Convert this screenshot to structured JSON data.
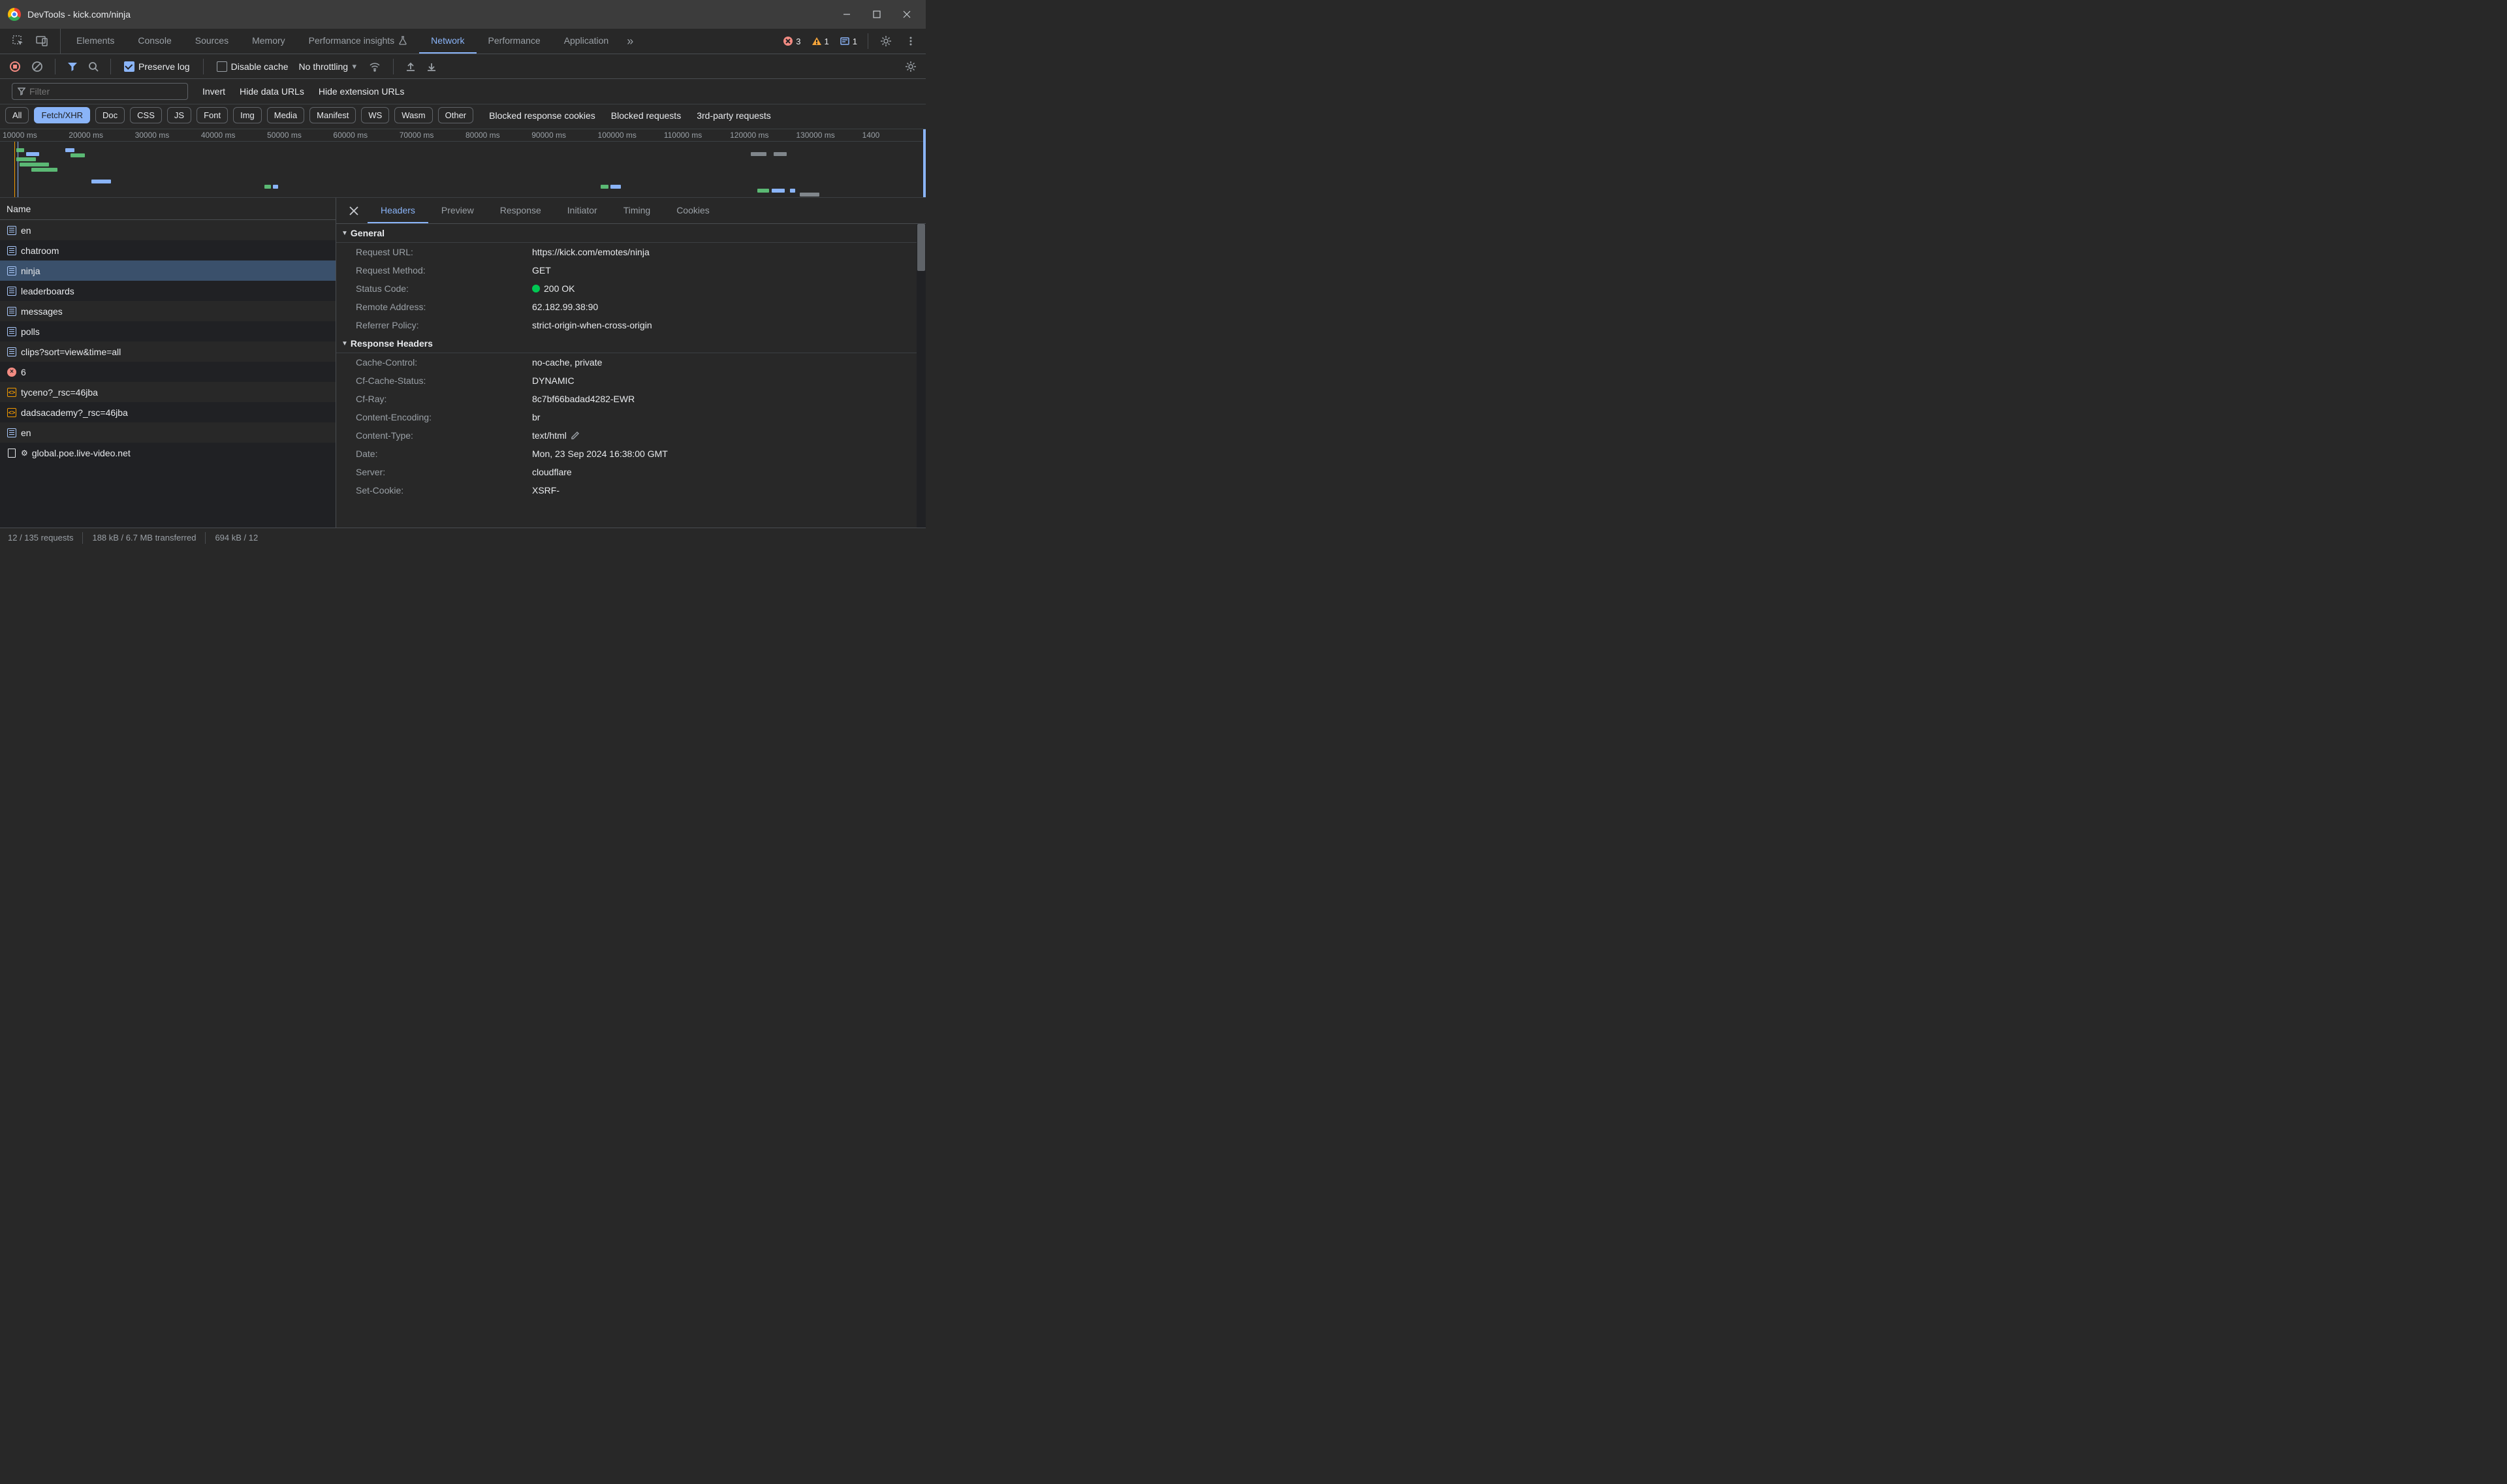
{
  "titlebar": {
    "title": "DevTools - kick.com/ninja"
  },
  "main_tabs": {
    "items": [
      {
        "label": "Elements",
        "active": false
      },
      {
        "label": "Console",
        "active": false
      },
      {
        "label": "Sources",
        "active": false
      },
      {
        "label": "Memory",
        "active": false
      },
      {
        "label": "Performance insights",
        "active": false,
        "flask": true
      },
      {
        "label": "Network",
        "active": true
      },
      {
        "label": "Performance",
        "active": false
      },
      {
        "label": "Application",
        "active": false
      }
    ]
  },
  "counters": {
    "errors": "3",
    "warnings": "1",
    "info": "1"
  },
  "net_toolbar": {
    "preserve_log_label": "Preserve log",
    "preserve_log": true,
    "disable_cache_label": "Disable cache",
    "disable_cache": false,
    "throttling": "No throttling"
  },
  "filter_row": {
    "placeholder": "Filter",
    "invert_label": "Invert",
    "hide_data_label": "Hide data URLs",
    "hide_ext_label": "Hide extension URLs"
  },
  "type_filters": {
    "items": [
      "All",
      "Fetch/XHR",
      "Doc",
      "CSS",
      "JS",
      "Font",
      "Img",
      "Media",
      "Manifest",
      "WS",
      "Wasm",
      "Other"
    ],
    "active": "Fetch/XHR",
    "blocked_cookies_label": "Blocked response cookies",
    "blocked_requests_label": "Blocked requests",
    "third_party_label": "3rd-party requests"
  },
  "timeline": {
    "ticks": [
      "10000 ms",
      "20000 ms",
      "30000 ms",
      "40000 ms",
      "50000 ms",
      "60000 ms",
      "70000 ms",
      "80000 ms",
      "90000 ms",
      "100000 ms",
      "110000 ms",
      "120000 ms",
      "130000 ms",
      "1400"
    ]
  },
  "requests": {
    "header": "Name",
    "rows": [
      {
        "icon": "fetch",
        "name": "en"
      },
      {
        "icon": "fetch",
        "name": "chatroom"
      },
      {
        "icon": "fetch",
        "name": "ninja",
        "selected": true
      },
      {
        "icon": "fetch",
        "name": "leaderboards"
      },
      {
        "icon": "fetch",
        "name": "messages"
      },
      {
        "icon": "fetch",
        "name": "polls"
      },
      {
        "icon": "fetch",
        "name": "clips?sort=view&time=all"
      },
      {
        "icon": "error",
        "name": "6"
      },
      {
        "icon": "socket",
        "name": "tyceno?_rsc=46jba"
      },
      {
        "icon": "socket",
        "name": "dadsacademy?_rsc=46jba"
      },
      {
        "icon": "fetch",
        "name": "en"
      },
      {
        "icon": "doc-gear",
        "name": "global.poe.live-video.net"
      }
    ]
  },
  "detail": {
    "tabs": [
      "Headers",
      "Preview",
      "Response",
      "Initiator",
      "Timing",
      "Cookies"
    ],
    "active_tab": "Headers",
    "sections": {
      "general": {
        "title": "General",
        "items": [
          {
            "k": "Request URL:",
            "v": "https://kick.com/emotes/ninja"
          },
          {
            "k": "Request Method:",
            "v": "GET"
          },
          {
            "k": "Status Code:",
            "v": "200 OK",
            "status_dot": true
          },
          {
            "k": "Remote Address:",
            "v": "62.182.99.38:90"
          },
          {
            "k": "Referrer Policy:",
            "v": "strict-origin-when-cross-origin"
          }
        ]
      },
      "response_headers": {
        "title": "Response Headers",
        "items": [
          {
            "k": "Cache-Control:",
            "v": "no-cache, private"
          },
          {
            "k": "Cf-Cache-Status:",
            "v": "DYNAMIC"
          },
          {
            "k": "Cf-Ray:",
            "v": "8c7bf66badad4282-EWR"
          },
          {
            "k": "Content-Encoding:",
            "v": "br"
          },
          {
            "k": "Content-Type:",
            "v": "text/html",
            "editable": true
          },
          {
            "k": "Date:",
            "v": "Mon, 23 Sep 2024 16:38:00 GMT"
          },
          {
            "k": "Server:",
            "v": "cloudflare"
          },
          {
            "k": "Set-Cookie:",
            "v": "XSRF-"
          }
        ]
      }
    }
  },
  "status": {
    "requests": "12 / 135 requests",
    "transferred": "188 kB / 6.7 MB transferred",
    "resources": "694 kB / 12"
  }
}
